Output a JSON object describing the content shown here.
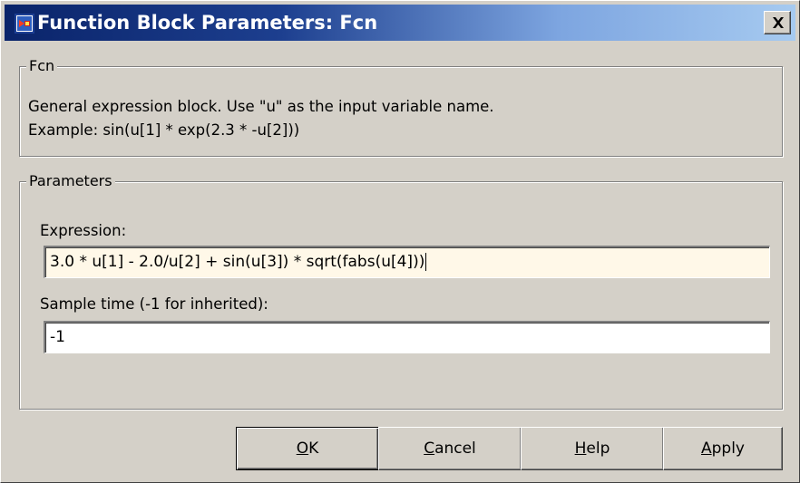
{
  "window": {
    "title": "Function Block Parameters: Fcn",
    "icon": "simulink-block-icon",
    "close_icon": "close-icon"
  },
  "fcn_group": {
    "label": "Fcn",
    "description_line1": "General expression block. Use \"u\" as the input variable name.",
    "description_line2": "Example: sin(u[1] * exp(2.3 * -u[2]))"
  },
  "parameters_group": {
    "label": "Parameters",
    "expression_label": "Expression:",
    "expression_value": "3.0 * u[1] - 2.0/u[2] + sin(u[3]) * sqrt(fabs(u[4]))",
    "sample_time_label": "Sample time (-1 for inherited):",
    "sample_time_value": "-1"
  },
  "buttons": {
    "ok": {
      "mnemonic": "O",
      "rest": "K"
    },
    "cancel": {
      "mnemonic": "C",
      "rest": "ancel"
    },
    "help": {
      "mnemonic": "H",
      "rest": "elp"
    },
    "apply": {
      "mnemonic": "A",
      "rest": "pply"
    }
  },
  "colors": {
    "dialog_bg": "#d4d0c8",
    "title_gradient_start": "#0a246a",
    "title_gradient_end": "#a6caf0",
    "focused_field_bg": "#fff8e8",
    "field_bg": "#ffffff"
  }
}
